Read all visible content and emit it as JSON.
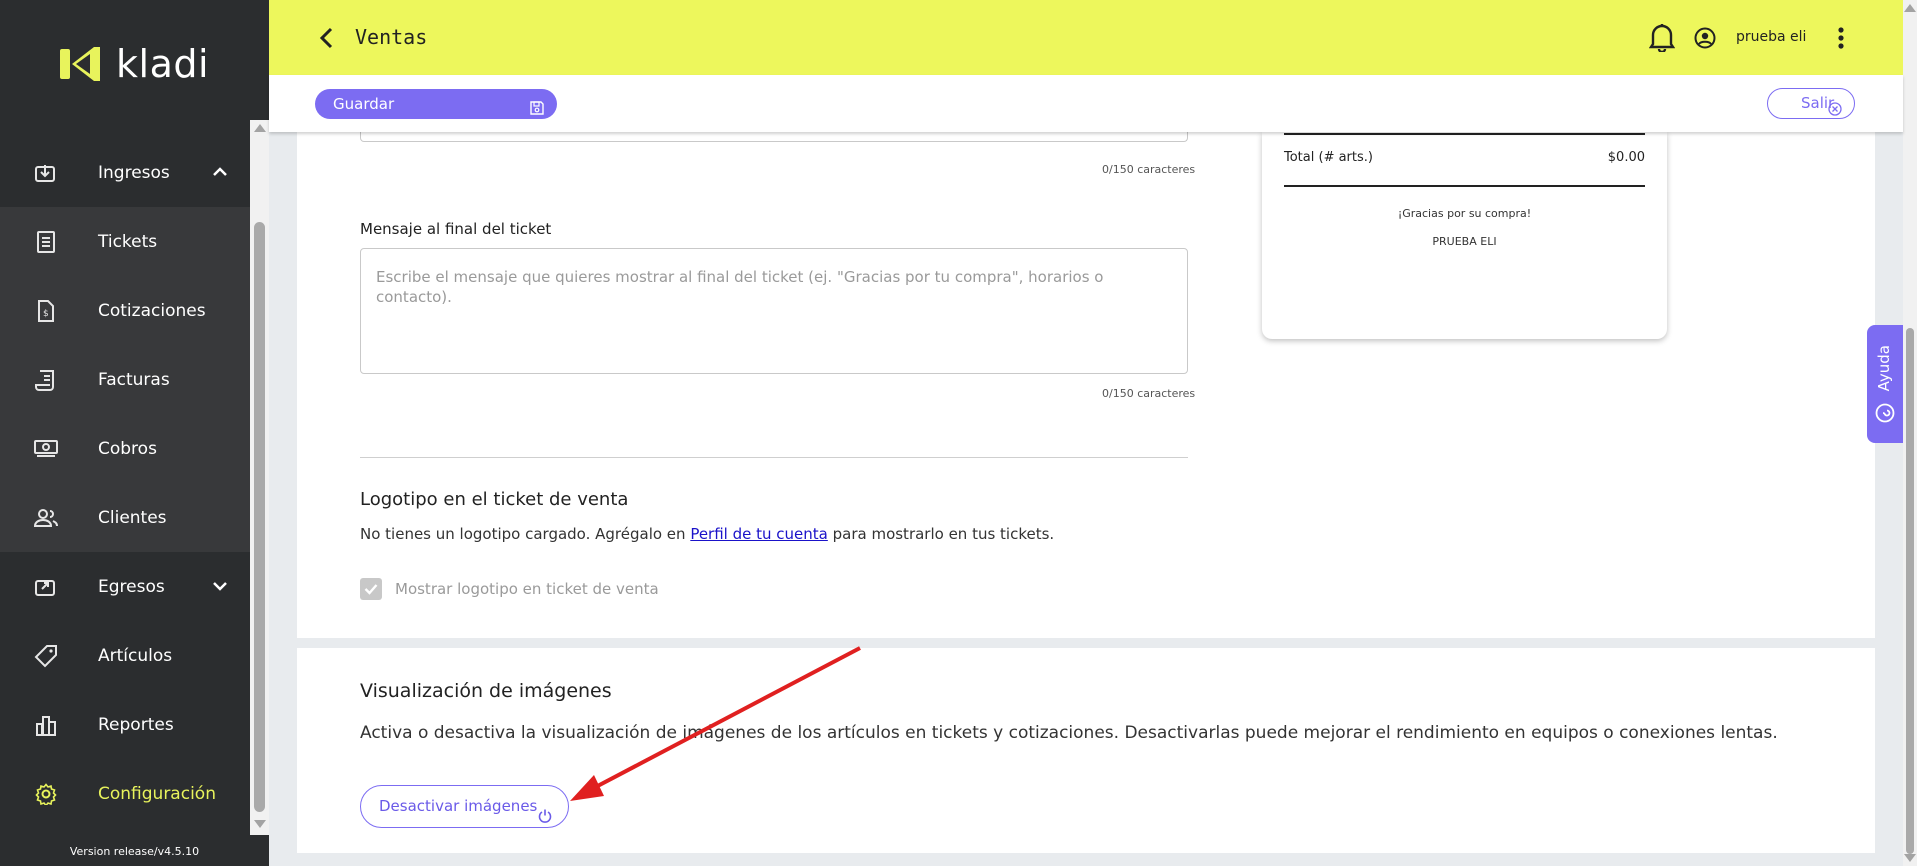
{
  "app": {
    "brand": "kladi",
    "version": "Version release/v4.5.10"
  },
  "colors": {
    "topbar": "#edf75c",
    "accent": "#7c6cf2",
    "sidebar": "#2b2d2f",
    "active": "#e8f35c",
    "annotation": "#e02020"
  },
  "sidebar": {
    "items": [
      {
        "label": "Ingresos",
        "icon": "income-icon",
        "expanded": true
      },
      {
        "label": "Tickets",
        "icon": "ticket-icon"
      },
      {
        "label": "Cotizaciones",
        "icon": "quote-document-icon"
      },
      {
        "label": "Facturas",
        "icon": "invoice-icon"
      },
      {
        "label": "Cobros",
        "icon": "cash-icon"
      },
      {
        "label": "Clientes",
        "icon": "clients-icon"
      },
      {
        "label": "Egresos",
        "icon": "expenses-icon",
        "expanded": false
      },
      {
        "label": "Artículos",
        "icon": "tag-icon"
      },
      {
        "label": "Reportes",
        "icon": "reports-icon"
      },
      {
        "label": "Configuración",
        "icon": "gear-icon",
        "active": true
      }
    ]
  },
  "header": {
    "title": "Ventas",
    "username": "prueba eli"
  },
  "actions": {
    "save_label": "Guardar",
    "exit_label": "Salir"
  },
  "ticket_settings": {
    "top_counter": "0/150 caracteres",
    "end_message_label": "Mensaje al final del ticket",
    "end_message_placeholder": "Escribe el mensaje que quieres mostrar al final del ticket (ej. \"Gracias por tu compra\", horarios o contacto).",
    "end_message_counter": "0/150 caracteres",
    "logo_title": "Logotipo en el ticket de venta",
    "logo_text_before": "No tienes un logotipo cargado. Agrégalo en ",
    "logo_link": "Perfil de tu cuenta",
    "logo_text_after": " para mostrarlo en tus tickets.",
    "logo_checkbox_label": "Mostrar logotipo en ticket de venta",
    "logo_checkbox_checked": true
  },
  "receipt_preview": {
    "total_label": "Total (# arts.)",
    "total_amount": "$0.00",
    "thanks": "¡Gracias por su compra!",
    "business_name": "PRUEBA ELI"
  },
  "images_section": {
    "title": "Visualización de imágenes",
    "description": "Activa o desactiva la visualización de imágenes de los artículos en tickets y cotizaciones. Desactivarlas puede mejorar el rendimiento en equipos o conexiones lentas.",
    "button_label": "Desactivar imágenes"
  },
  "help": {
    "label": "Ayuda"
  }
}
